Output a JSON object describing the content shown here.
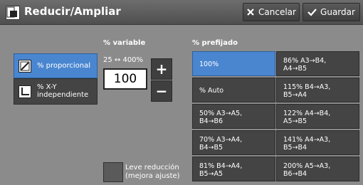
{
  "header": {
    "title": "Reducir/Ampliar",
    "cancel_label": "Cancelar",
    "save_label": "Guardar",
    "icons": [
      "reduce-enlarge-icon",
      "cancel-x-icon",
      "checkmark-icon"
    ]
  },
  "variable": {
    "label": "% variable",
    "range": "25 ↔ 400%",
    "value": "100",
    "modes": [
      {
        "label": "% proporcional",
        "selected": true,
        "icon": "proportional-icon"
      },
      {
        "label_line1": "% X-Y",
        "label_line2": "independiente",
        "selected": false,
        "icon": "xy-independent-icon"
      }
    ],
    "leve_line1": "Leve reducción",
    "leve_line2": "(mejora ajuste)"
  },
  "preset": {
    "label": "% prefijado",
    "cells": [
      {
        "line1": "100%",
        "line2": "",
        "selected": true
      },
      {
        "line1": "86% A3→B4,",
        "line2": "A4→B5",
        "selected": false
      },
      {
        "line1": "% Auto",
        "line2": "",
        "selected": false
      },
      {
        "line1": "115% B4→A3,",
        "line2": "B5→A4",
        "selected": false
      },
      {
        "line1": "50% A3→A5,",
        "line2": "B4→B6",
        "selected": false
      },
      {
        "line1": "122% A4→B4,",
        "line2": "A5→B5",
        "selected": false
      },
      {
        "line1": "70% A3→A4,",
        "line2": "B4→B5",
        "selected": false
      },
      {
        "line1": "141% A4→A3,",
        "line2": "B5→B4",
        "selected": false
      },
      {
        "line1": "81% B4→A4,",
        "line2": "B5→A5",
        "selected": false
      },
      {
        "line1": "200% A5→A3,",
        "line2": "B6→B4",
        "selected": false
      }
    ]
  },
  "colors": {
    "selected": "#4a86d0",
    "button": "#444444",
    "background": "#8b8b8b"
  }
}
